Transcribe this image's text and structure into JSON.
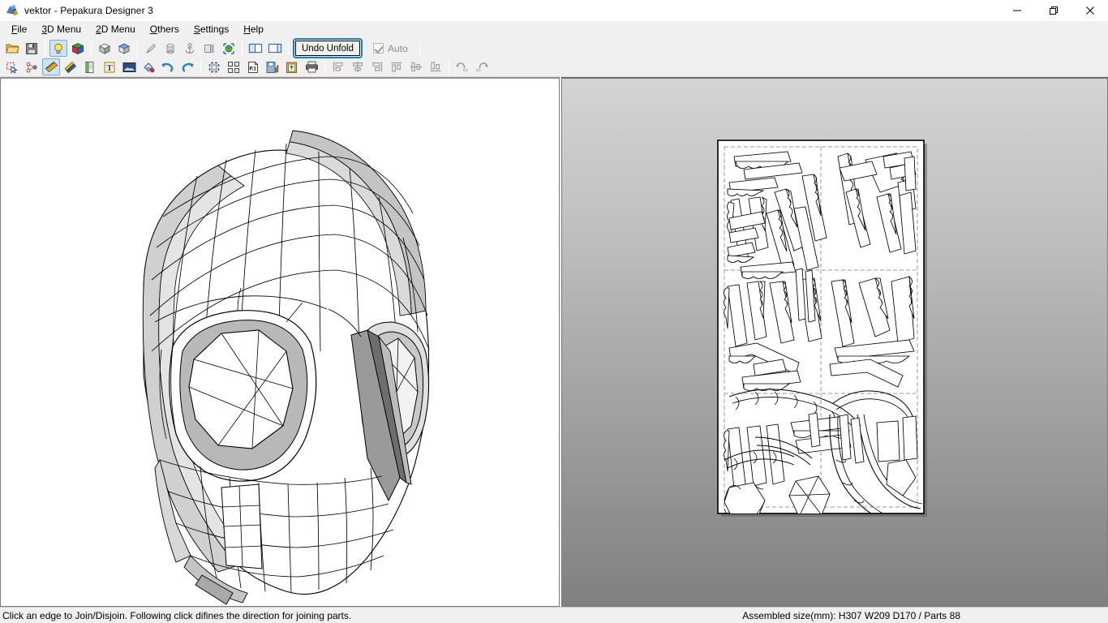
{
  "window": {
    "title": "vektor - Pepakura Designer 3",
    "app_icon": "pepakura-app-icon",
    "controls": [
      {
        "name": "minimize",
        "glyph": "minimize-icon"
      },
      {
        "name": "restore",
        "glyph": "restore-icon"
      },
      {
        "name": "close",
        "glyph": "close-icon"
      }
    ]
  },
  "menubar": {
    "items": [
      {
        "label": "File",
        "accel": "F"
      },
      {
        "label": "3D Menu",
        "accel": "3"
      },
      {
        "label": "2D Menu",
        "accel": "2"
      },
      {
        "label": "Others",
        "accel": "O"
      },
      {
        "label": "Settings",
        "accel": "S"
      },
      {
        "label": "Help",
        "accel": "H"
      }
    ]
  },
  "toolbar_row1": {
    "items": [
      {
        "icon": "open-folder-icon",
        "enabled": true,
        "active": false
      },
      {
        "icon": "save-floppy-icon",
        "enabled": true,
        "active": false
      },
      {
        "icon": "separator",
        "enabled": false,
        "active": false
      },
      {
        "icon": "lightbulb-icon",
        "enabled": true,
        "active": true
      },
      {
        "icon": "rgb-cube-icon",
        "enabled": true,
        "active": false
      },
      {
        "icon": "separator",
        "enabled": false,
        "active": false
      },
      {
        "icon": "gray-cube-icon",
        "enabled": true,
        "active": false
      },
      {
        "icon": "textured-cube-icon",
        "enabled": true,
        "active": false
      },
      {
        "icon": "separator",
        "enabled": false,
        "active": false
      },
      {
        "icon": "pencil-icon",
        "enabled": false,
        "active": false
      },
      {
        "icon": "cylinder-icon",
        "enabled": false,
        "active": false
      },
      {
        "icon": "anchor-icon",
        "enabled": false,
        "active": false
      },
      {
        "icon": "panel-split-icon",
        "enabled": false,
        "active": false
      },
      {
        "icon": "green-globe-icon",
        "enabled": true,
        "active": false
      },
      {
        "icon": "separator",
        "enabled": false,
        "active": false
      },
      {
        "icon": "layout-vertical-icon",
        "enabled": true,
        "active": false
      },
      {
        "icon": "layout-horizontal-icon",
        "enabled": true,
        "active": false
      }
    ],
    "undo_unfold_label": "Undo Unfold",
    "auto_label": "Auto",
    "auto_checked": true,
    "auto_enabled": false
  },
  "toolbar_row2": {
    "items": [
      {
        "icon": "select-arrow-icon",
        "enabled": true,
        "active": false
      },
      {
        "icon": "join-disjoin-icon",
        "enabled": true,
        "active": false
      },
      {
        "icon": "edge-ruler-icon",
        "enabled": true,
        "active": true
      },
      {
        "icon": "colored-pencils-icon",
        "enabled": true,
        "active": false
      },
      {
        "icon": "edit-flaps-icon",
        "enabled": true,
        "active": false
      },
      {
        "icon": "text-tool-icon",
        "enabled": true,
        "active": false
      },
      {
        "icon": "image-texture-icon",
        "enabled": true,
        "active": false
      },
      {
        "icon": "paint-bucket-icon",
        "enabled": true,
        "active": false
      },
      {
        "icon": "undo-icon",
        "enabled": true,
        "active": false
      },
      {
        "icon": "redo-icon",
        "enabled": true,
        "active": false
      },
      {
        "icon": "separator",
        "enabled": false,
        "active": false
      },
      {
        "icon": "marquee-select-icon",
        "enabled": true,
        "active": false
      },
      {
        "icon": "arrange-parts-icon",
        "enabled": true,
        "active": false
      },
      {
        "icon": "page-number-icon",
        "enabled": true,
        "active": false
      },
      {
        "icon": "save-chart-icon",
        "enabled": true,
        "active": false
      },
      {
        "icon": "clipboard-copy-icon",
        "enabled": true,
        "active": false
      },
      {
        "icon": "print-icon",
        "enabled": true,
        "active": false
      },
      {
        "icon": "separator",
        "enabled": false,
        "active": false
      },
      {
        "icon": "align-left-icon",
        "enabled": false,
        "active": false
      },
      {
        "icon": "align-center-h-icon",
        "enabled": false,
        "active": false
      },
      {
        "icon": "align-right-icon",
        "enabled": false,
        "active": false
      },
      {
        "icon": "align-top-icon",
        "enabled": false,
        "active": false
      },
      {
        "icon": "align-center-v-icon",
        "enabled": false,
        "active": false
      },
      {
        "icon": "align-bottom-icon",
        "enabled": false,
        "active": false
      },
      {
        "icon": "separator",
        "enabled": false,
        "active": false
      },
      {
        "icon": "rotate-ccw-90-icon",
        "enabled": false,
        "active": false
      },
      {
        "icon": "rotate-cw-90-icon",
        "enabled": false,
        "active": false
      }
    ],
    "page_number_label": "P.1",
    "rotate_ccw_label": "90",
    "rotate_cw_label": "90"
  },
  "viewport_3d": {
    "name": "3d-model-view",
    "model": "low-poly mask head (Spider-Man style) shown three-quarter left",
    "background": "#ffffff"
  },
  "viewport_2d": {
    "name": "2d-unfold-view",
    "sheet": "single portrait page of unfolded papercraft parts with glue tabs",
    "background_top": "#d4d4d4",
    "background_bottom": "#808080",
    "sheet_color": "#ffffff"
  },
  "statusbar": {
    "hint": "Click an edge to Join/Disjoin. Following click difines the direction for joining parts.",
    "assembled_info": "Assembled size(mm): H307 W209 D170 / Parts 88"
  }
}
